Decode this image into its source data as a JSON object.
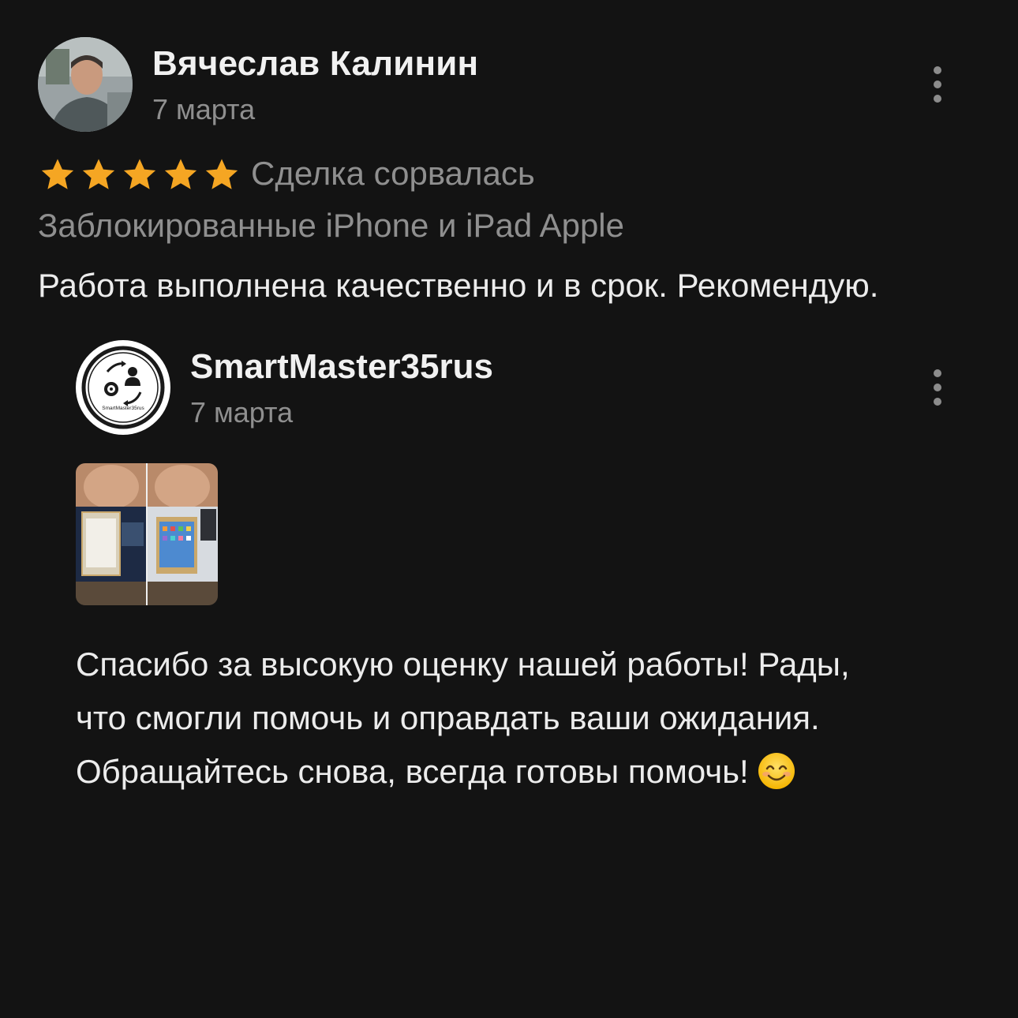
{
  "review": {
    "author_name": "Вячеслав Калинин",
    "date": "7 марта",
    "rating": 5,
    "max_rating": 5,
    "deal_status": "Сделка сорвалась",
    "category": "Заблокированные iPhone и iPad Apple",
    "text": "Работа выполнена качественно и в срок. Рекомендую."
  },
  "reply": {
    "author_name": "SmartMaster35rus",
    "date": "7 марта",
    "avatar_logo_text": "SmartMaster35rus",
    "photo_count": 1,
    "text_lines": [
      "Спасибо за высокую оценку нашей работы! Рады,",
      "что смогли помочь и оправдать ваши ожидания.",
      "Обращайтесь снова, всегда готовы помочь!"
    ],
    "emoji": "smiling-face"
  },
  "colors": {
    "background": "#131313",
    "star": "#f5a623",
    "primary_text": "#ececec",
    "secondary_text": "#8f8f8f"
  },
  "icons": {
    "more": "vertical-dots-icon",
    "star": "star-icon"
  }
}
